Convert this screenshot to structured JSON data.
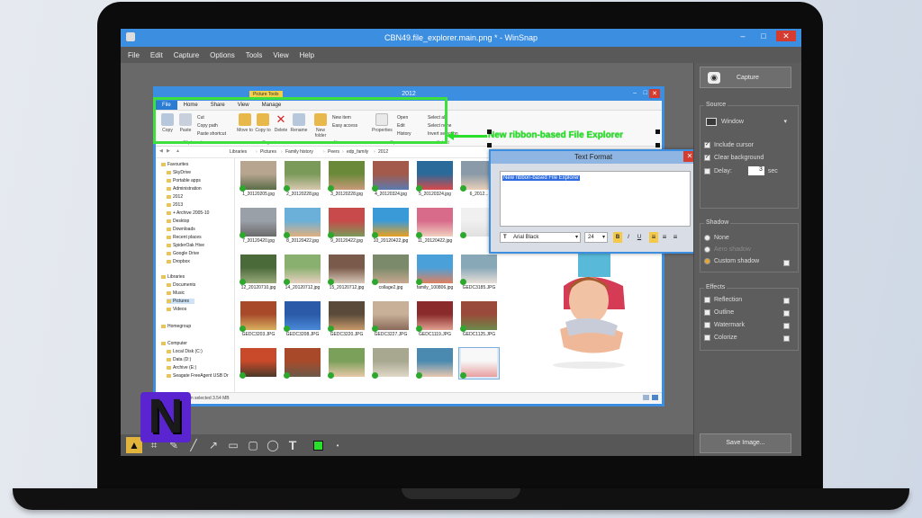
{
  "winsnap": {
    "title": "CBN49.file_explorer.main.png * - WinSnap",
    "menu": [
      "File",
      "Edit",
      "Capture",
      "Options",
      "Tools",
      "View",
      "Help"
    ],
    "capture_button": "Capture",
    "source": {
      "label": "Source",
      "mode": "Window",
      "include_cursor": "Include cursor",
      "clear_background": "Clear background",
      "delay_label": "Delay:",
      "delay_value": "3",
      "delay_unit": "sec"
    },
    "shadow": {
      "label": "Shadow",
      "none": "None",
      "aero": "Aero shadow",
      "custom": "Custom shadow"
    },
    "effects": {
      "label": "Effects",
      "items": [
        "Reflection",
        "Outline",
        "Watermark",
        "Colorize"
      ]
    },
    "save_button": "Save Image..."
  },
  "explorer": {
    "title": "2012",
    "picture_tools": "Picture Tools",
    "tabs": [
      "File",
      "Home",
      "Share",
      "View",
      "Manage"
    ],
    "ribbon": {
      "copy": "Copy",
      "paste": "Paste",
      "cut": "Cut",
      "copy_path": "Copy path",
      "paste_shortcut": "Paste shortcut",
      "move_to": "Move to",
      "copy_to": "Copy to",
      "delete": "Delete",
      "rename": "Rename",
      "new_folder": "New folder",
      "new_item": "New item",
      "easy_access": "Easy access",
      "properties": "Properties",
      "open": "Open",
      "edit": "Edit",
      "history": "History",
      "select_all": "Select all",
      "select_none": "Select none",
      "invert_selection": "Invert selection",
      "groups": [
        "Clipboard",
        "Organize",
        "New",
        "Open",
        "Select"
      ]
    },
    "address": [
      "Libraries",
      "Pictures",
      "Family history",
      "Peers",
      "edp_family",
      "2012"
    ],
    "nav": [
      "Favourites",
      "SkyDrive",
      "Portable apps",
      "Administration",
      "2012",
      "2013",
      "+ Archive 2005-10",
      "Desktop",
      "Downloads",
      "Recent places",
      "SpiderOak Hive",
      "Google Drive",
      "Dropbox",
      "Libraries",
      "Documents",
      "Music",
      "Pictures",
      "Videos",
      "Homegroup",
      "Computer",
      "Local Disk (C:)",
      "Data (D:)",
      "Archive (E:)",
      "Seagate FreeAgent USB Dr"
    ],
    "files": [
      "1_20120205.jpg",
      "2_20120228.jpg",
      "3_20120228.jpg",
      "4_20120324.jpg",
      "5_20120324.jpg",
      "6_2012...",
      "7_20120420.jpg",
      "8_20120422.jpg",
      "9_20120422.jpg",
      "10_20120422.jpg",
      "11_20120422.jpg",
      "",
      "12_20120710.jpg",
      "14_20120712.jpg",
      "15_20120712.jpg",
      "collage2.jpg",
      "family_100806.jpg",
      "GEDC3185.JPG",
      "GEDC3203.JPG",
      "GEDC3208.JPG",
      "GEDC3220.JPG",
      "GEDC3227.JPG",
      "GEDC1119.JPG",
      "GEDC1125.JPG",
      "",
      "",
      "",
      "",
      "",
      ""
    ],
    "status": "1 item selected  3.54 MB"
  },
  "text_format": {
    "title": "Text Format",
    "text": "New ribbon-based File Explorer",
    "font": "Arial Black",
    "size": "24",
    "bold": "B",
    "italic": "I",
    "underline": "U"
  },
  "annotation": "New ribbon-based File Explorer",
  "logo": "N"
}
